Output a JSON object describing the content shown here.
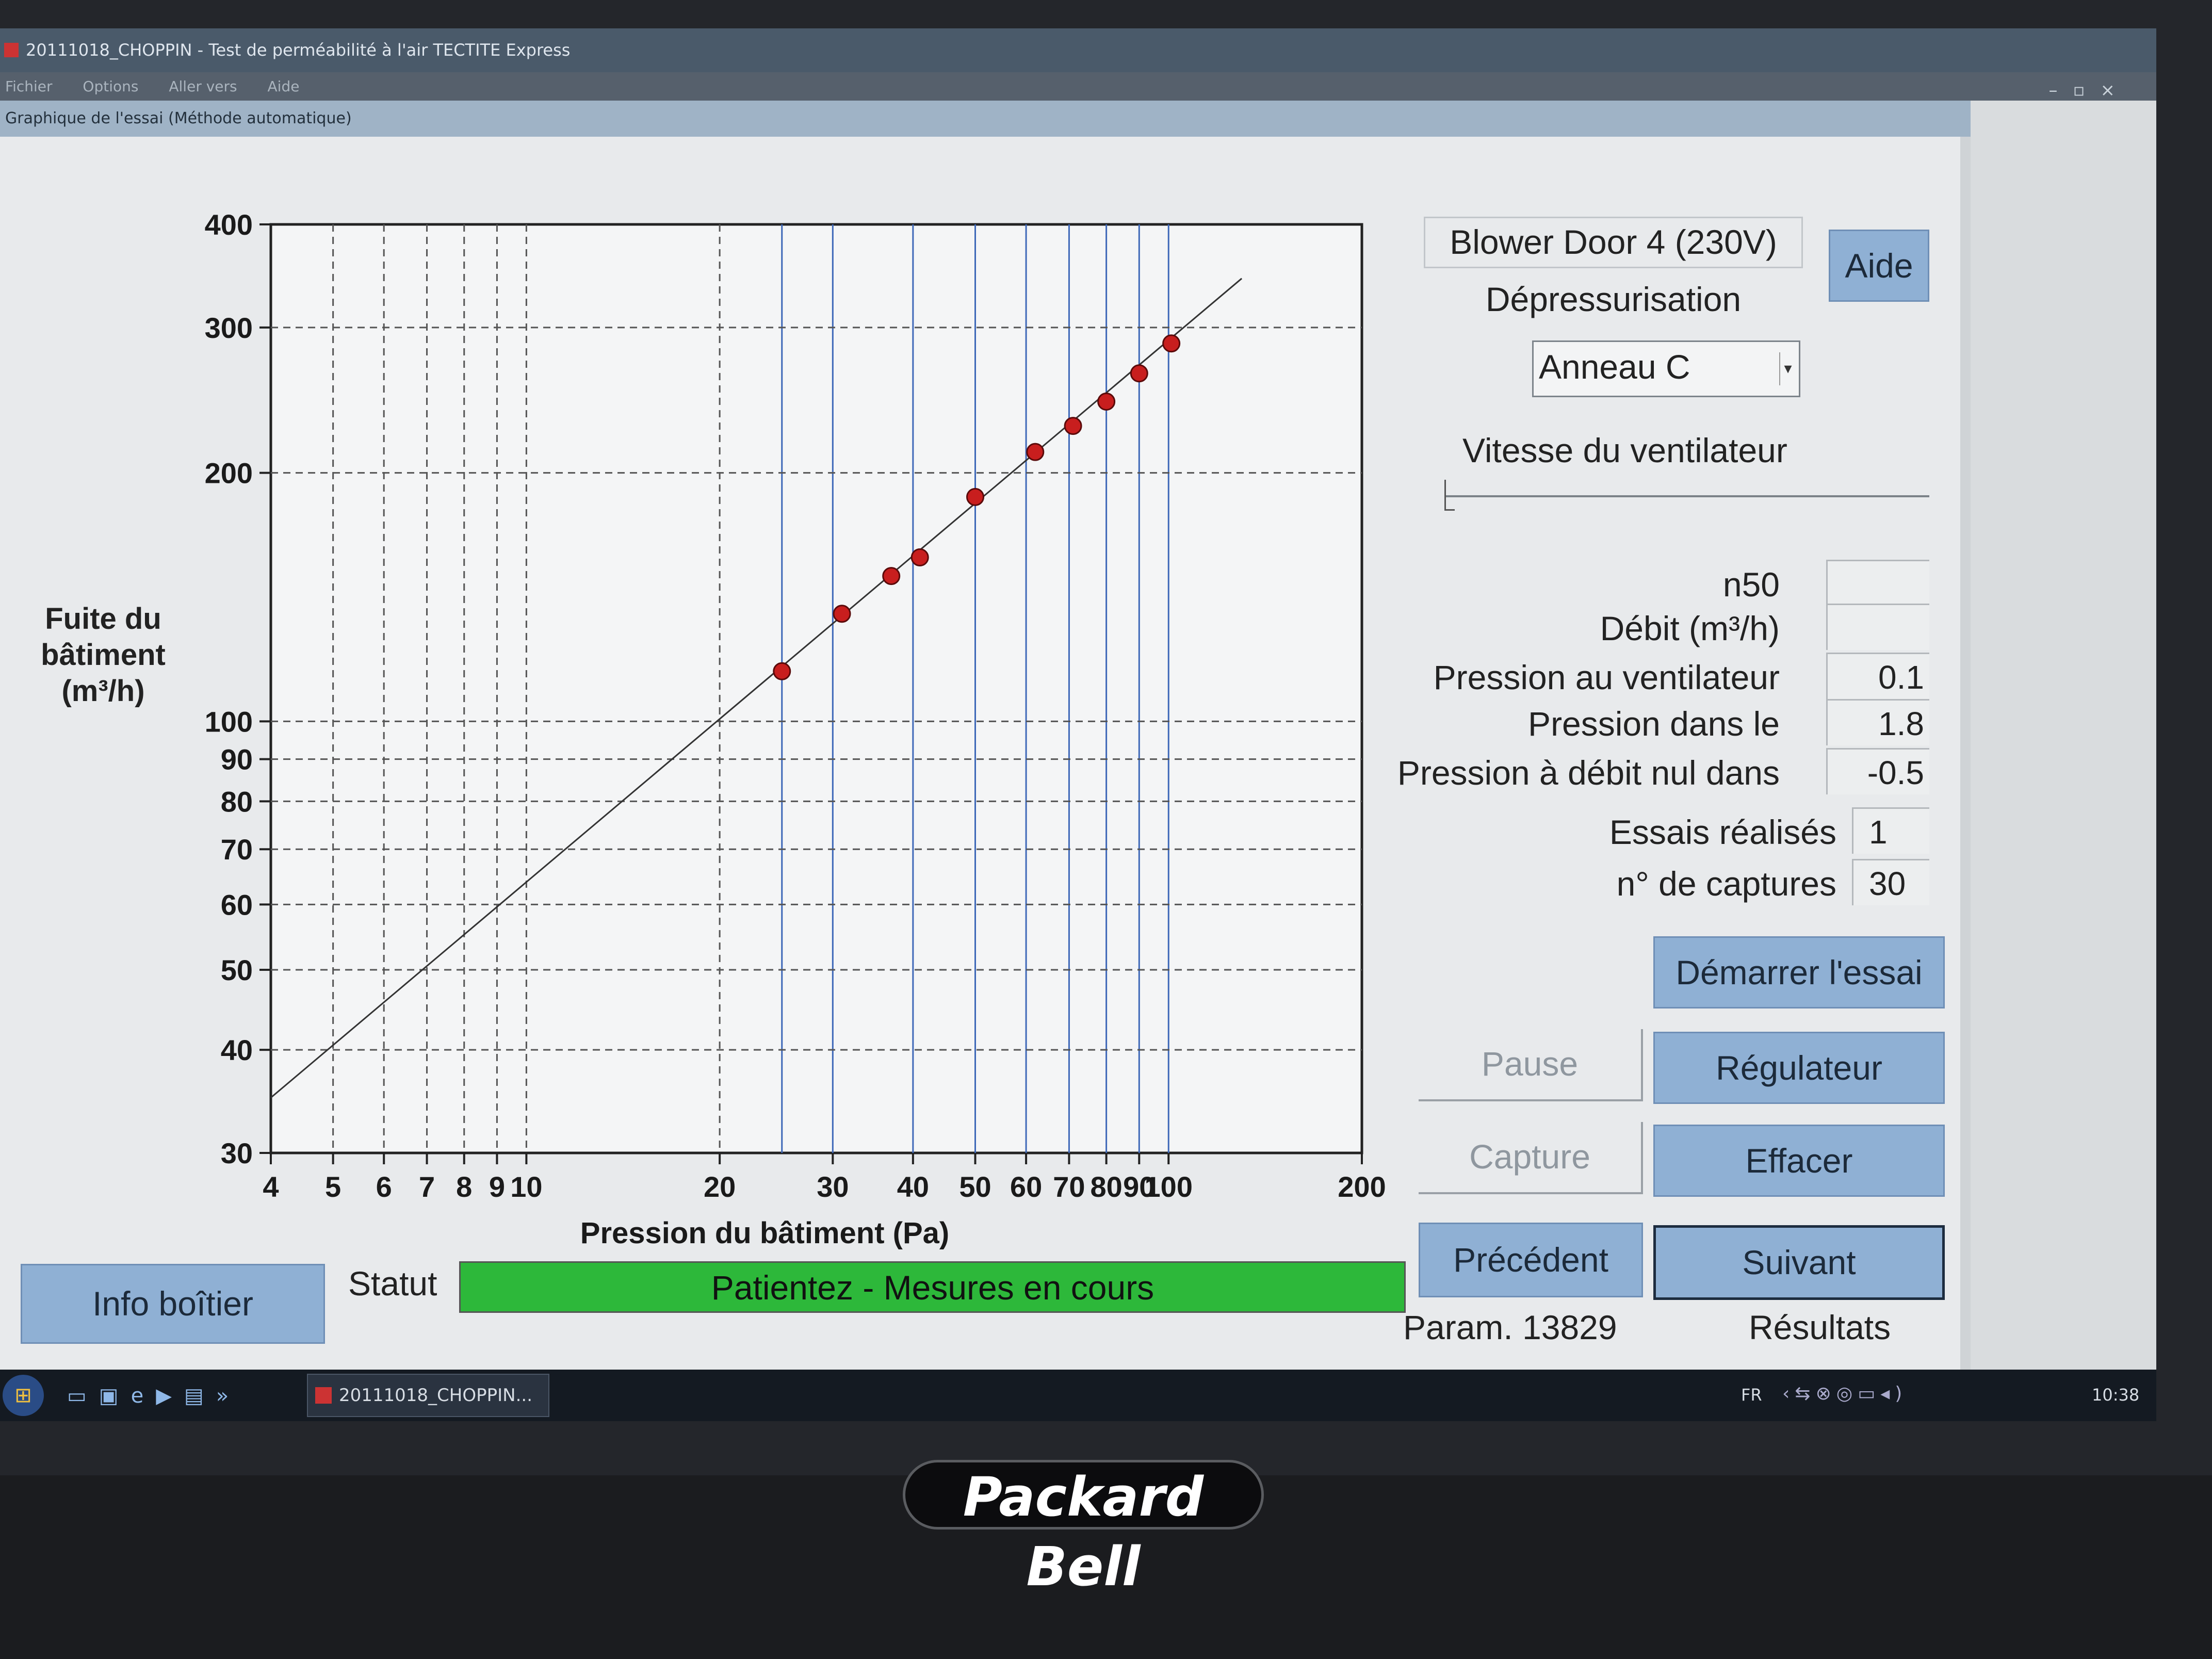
{
  "window": {
    "title": "20111018_CHOPPIN - Test de perméabilité à l'air TECTITE Express",
    "menu": [
      "Fichier",
      "Options",
      "Aller vers",
      "Aide"
    ],
    "subwindow_title": "Graphique de l'essai (Méthode automatique)"
  },
  "device": {
    "model": "Blower Door 4 (230V)",
    "mode": "Dépressurisation",
    "ring_select": "Anneau C",
    "help_button": "Aide",
    "fan_speed_label": "Vitesse du ventilateur",
    "fan_speed_level": 0
  },
  "readings": [
    {
      "label": "n50",
      "value": ""
    },
    {
      "label": "Débit (m³/h)",
      "value": ""
    },
    {
      "label": "Pression au ventilateur",
      "value": "0.1"
    },
    {
      "label": "Pression dans le",
      "value": "1.8"
    },
    {
      "label": "Pression à débit nul dans",
      "value": "-0.5"
    }
  ],
  "counters": [
    {
      "label": "Essais réalisés",
      "value": "1"
    },
    {
      "label": "n° de captures",
      "value": "30"
    }
  ],
  "buttons": {
    "start": "Démarrer l'essai",
    "pause": "Pause",
    "regulator": "Régulateur",
    "capture": "Capture",
    "clear": "Effacer",
    "previous": "Précédent",
    "next": "Suivant",
    "box_info": "Info boîtier"
  },
  "footer": {
    "params": "Param. 13829",
    "results": "Résultats",
    "status_label": "Statut",
    "status_text": "Patientez - Mesures en cours",
    "status_color": "#2db83a"
  },
  "taskbar": {
    "task": "20111018_CHOPPIN...",
    "lang": "FR",
    "time": "10:38"
  },
  "laptop_brand": "Packard Bell",
  "chart_data": {
    "type": "scatter",
    "xlabel": "Pression du bâtiment (Pa)",
    "ylabel": "Fuite du bâtiment (m³/h)",
    "xscale": "log",
    "yscale": "log",
    "xlim": [
      4,
      200
    ],
    "ylim": [
      30,
      400
    ],
    "x_ticks": [
      4,
      5,
      6,
      7,
      8,
      9,
      10,
      20,
      30,
      40,
      50,
      60,
      70,
      80,
      90,
      100,
      200
    ],
    "y_ticks": [
      30,
      40,
      50,
      60,
      70,
      80,
      90,
      100,
      200,
      300,
      400
    ],
    "grid": true,
    "points": [
      {
        "x": 25,
        "y": 115
      },
      {
        "x": 31,
        "y": 135
      },
      {
        "x": 37,
        "y": 150
      },
      {
        "x": 41,
        "y": 158
      },
      {
        "x": 50,
        "y": 187
      },
      {
        "x": 62,
        "y": 212
      },
      {
        "x": 71,
        "y": 228
      },
      {
        "x": 80,
        "y": 244
      },
      {
        "x": 90,
        "y": 264
      },
      {
        "x": 101,
        "y": 287
      }
    ],
    "fit_line": [
      {
        "x": 4,
        "y": 35
      },
      {
        "x": 130,
        "y": 344
      }
    ],
    "point_color": "#c81e1e"
  }
}
